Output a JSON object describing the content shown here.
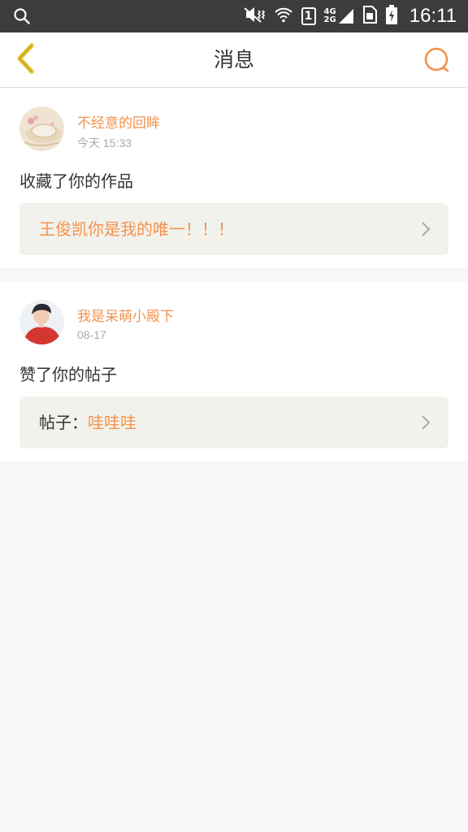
{
  "status_bar": {
    "time": "16:11",
    "sim_slot": "1",
    "network_top": "4G",
    "network_bottom": "2G",
    "icons": [
      "search-icon",
      "mute-vibrate-icon",
      "wifi-icon",
      "sim-icon",
      "signal-icon",
      "sim-card-icon",
      "battery-charging-icon"
    ]
  },
  "header": {
    "title": "消息",
    "back_icon": "chevron-left-icon",
    "search_icon": "search-icon"
  },
  "colors": {
    "accent": "#f4924c",
    "back_arrow": "#e8c530",
    "box_bg": "#f2f2ec"
  },
  "messages": [
    {
      "username": "不经意的回眸",
      "time": "今天 15:33",
      "action": "收藏了你的作品",
      "target_prefix": "",
      "target_text": "王俊凯你是我的唯一！！！"
    },
    {
      "username": "我是呆萌小殿下",
      "time": "08-17",
      "action": "赞了你的帖子",
      "target_prefix": "帖子：",
      "target_text": "哇哇哇"
    }
  ]
}
